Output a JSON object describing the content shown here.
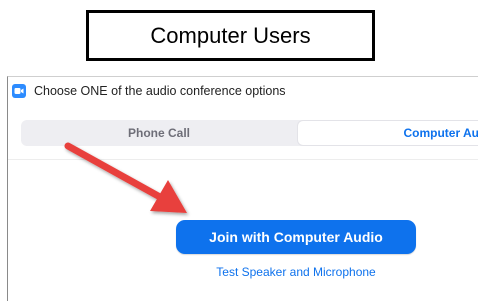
{
  "caption": "Computer Users",
  "dialog": {
    "title": "Choose ONE of the audio conference options",
    "tabs": [
      {
        "label": "Phone Call",
        "selected": false
      },
      {
        "label": "Computer Audio",
        "selected": true
      }
    ],
    "join_button_label": "Join with Computer Audio",
    "test_link_label": "Test Speaker and Microphone"
  },
  "colors": {
    "accent": "#0e72ed",
    "app_icon": "#2d8cff",
    "arrow": "#e8403c"
  },
  "icons": {
    "app_icon": "zoom-camera-icon",
    "annotation": "red-arrow-icon"
  }
}
